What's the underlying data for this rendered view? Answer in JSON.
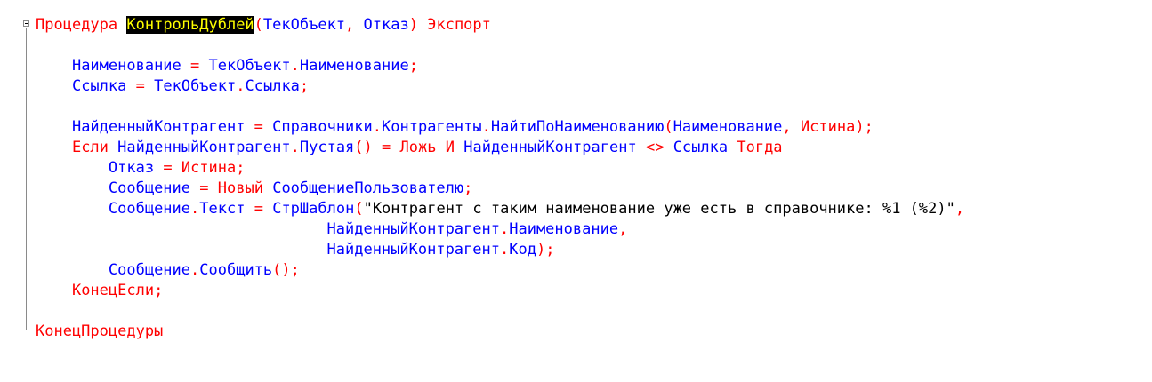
{
  "colors": {
    "keyword": "#ff0000",
    "identifier": "#0000ff",
    "string": "#000000",
    "highlight_bg": "#000000",
    "highlight_fg": "#ffff00",
    "background": "#ffffff"
  },
  "gutter": {
    "fold_icon": "collapse-minus-icon"
  },
  "code": {
    "l1": {
      "kw_proc": "Процедура",
      "proc_name": "КонтрольДублей",
      "paren_open": "(",
      "param1": "ТекОбъект",
      "comma": ",",
      "param2": "Отказ",
      "paren_close": ")",
      "kw_export": "Экспорт"
    },
    "l2": {
      "var": "Наименование",
      "eq": "=",
      "obj": "ТекОбъект",
      "dot": ".",
      "prop": "Наименование",
      "semi": ";"
    },
    "l3": {
      "var": "Ссылка",
      "eq": "=",
      "obj": "ТекОбъект",
      "dot": ".",
      "prop": "Ссылка",
      "semi": ";"
    },
    "l4": {
      "var": "НайденныйКонтрагент",
      "eq": "=",
      "a": "Справочники",
      "dot1": ".",
      "b": "Контрагенты",
      "dot2": ".",
      "c": "НайтиПоНаименованию",
      "paren_open": "(",
      "arg1": "Наименование",
      "comma": ",",
      "arg2": "Истина",
      "paren_close": ")",
      "semi": ";"
    },
    "l5": {
      "kw_if": "Если",
      "obj": "НайденныйКонтрагент",
      "dot": ".",
      "method": "Пустая",
      "parens": "()",
      "eq": "=",
      "kw_false": "Ложь",
      "kw_and": "И",
      "obj2": "НайденныйКонтрагент",
      "neq": "<>",
      "ref": "Ссылка",
      "kw_then": "Тогда"
    },
    "l6": {
      "var": "Отказ",
      "eq": "=",
      "val": "Истина",
      "semi": ";"
    },
    "l7": {
      "var": "Сообщение",
      "eq": "=",
      "kw_new": "Новый",
      "type": "СообщениеПользователю",
      "semi": ";"
    },
    "l8": {
      "obj": "Сообщение",
      "dot": ".",
      "prop": "Текст",
      "eq": "=",
      "func": "СтрШаблон",
      "paren_open": "(",
      "str": "\"Контрагент с таким наименование уже есть в справочнике: %1 (%2)\"",
      "comma": ","
    },
    "l9": {
      "obj": "НайденныйКонтрагент",
      "dot": ".",
      "prop": "Наименование",
      "comma": ","
    },
    "l10": {
      "obj": "НайденныйКонтрагент",
      "dot": ".",
      "prop": "Код",
      "paren_close": ")",
      "semi": ";"
    },
    "l11": {
      "obj": "Сообщение",
      "dot": ".",
      "method": "Сообщить",
      "parens": "()",
      "semi": ";"
    },
    "l12": {
      "kw": "КонецЕсли",
      "semi": ";"
    },
    "l13": {
      "kw": "КонецПроцедуры"
    }
  }
}
